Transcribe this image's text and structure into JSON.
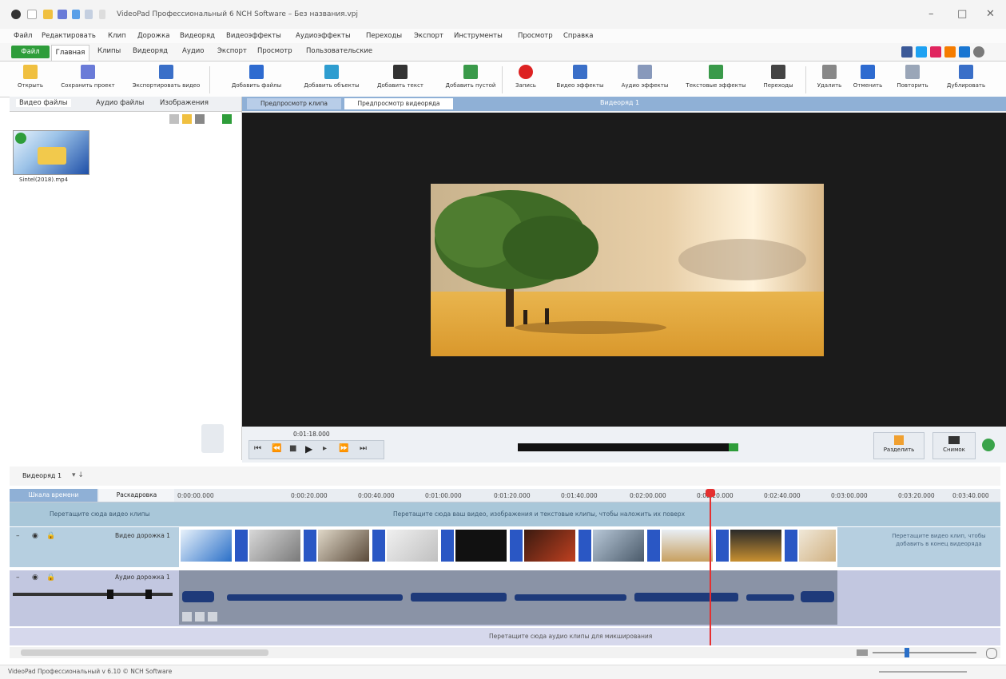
{
  "title_bar": {
    "title": "VideoPad Профессиональный 6 NCH Software – Без названия.vpj",
    "minimize": "–",
    "maximize": "□",
    "close": "✕"
  },
  "menu": [
    "Файл",
    "Редактировать",
    "Клип",
    "Дорожка",
    "Видеоряд",
    "Видеоэффекты",
    "Аудиоэффекты",
    "Переходы",
    "Экспорт",
    "Инструменты",
    "Просмотр",
    "Справка"
  ],
  "ribbon_tabs": {
    "file": "Файл",
    "home": "Главная",
    "others": [
      "Клипы",
      "Видеоряд",
      "Аудио",
      "Экспорт",
      "Просмотр",
      "Пользовательские"
    ]
  },
  "ribbon_buttons": [
    {
      "label": "Открыть",
      "icon": "folder-icon",
      "color": "#f0c040"
    },
    {
      "label": "Сохранить проект",
      "icon": "save-icon",
      "color": "#6a7bd8"
    },
    {
      "label": "Экспортировать видео",
      "icon": "export-icon",
      "color": "#3a6fc8"
    },
    {
      "label": "Добавить файлы",
      "icon": "add-files-icon",
      "color": "#2e6bd0"
    },
    {
      "label": "Добавить объекты",
      "icon": "add-objects-icon",
      "color": "#2e9dd0"
    },
    {
      "label": "Добавить текст",
      "icon": "add-text-icon",
      "color": "#333333"
    },
    {
      "label": "Добавить пустой",
      "icon": "add-blank-icon",
      "color": "#3a9a4a"
    },
    {
      "label": "Запись",
      "icon": "record-icon",
      "color": "#dd2222"
    },
    {
      "label": "Видео эффекты",
      "icon": "video-effects-icon",
      "color": "#3a6fc8"
    },
    {
      "label": "Аудио эффекты",
      "icon": "audio-effects-icon",
      "color": "#8899bb"
    },
    {
      "label": "Текстовые эффекты",
      "icon": "text-effects-icon",
      "color": "#3a9a4a"
    },
    {
      "label": "Переходы",
      "icon": "transitions-icon",
      "color": "#444444"
    },
    {
      "label": "Удалить",
      "icon": "delete-icon",
      "color": "#888888"
    },
    {
      "label": "Отменить",
      "icon": "undo-icon",
      "color": "#2e6bd0"
    },
    {
      "label": "Повторить",
      "icon": "redo-icon",
      "color": "#9aa6b8"
    },
    {
      "label": "Дублировать",
      "icon": "duplicate-icon",
      "color": "#3a6fc8"
    }
  ],
  "left_panel": {
    "tabs": [
      "Видео файлы",
      "Аудио файлы",
      "Изображения"
    ],
    "file_name": "Sintel(2018).mp4"
  },
  "preview": {
    "tab_clip": "Предпросмотр клипа",
    "tab_sequence": "Предпросмотр видеоряда",
    "sequence_title": "Видеоряд 1",
    "time": "0:01:18.000",
    "split_label": "Разделить",
    "snapshot_label": "Снимок"
  },
  "timeline": {
    "sequence_tab": "Видеоряд 1",
    "tab_timeline": "Шкала времени",
    "tab_storyboard": "Раскадровка",
    "ticks": [
      "0:00:00.000",
      "0:00:20.000",
      "0:00:40.000",
      "0:01:00.000",
      "0:01:20.000",
      "0:01:40.000",
      "0:02:00.000",
      "0:02:20.000",
      "0:02:40.000",
      "0:03:00.000",
      "0:03:20.000",
      "0:03:40.000"
    ],
    "overlay_hint": "Перетащите сюда видео клипы",
    "overlay_label": "Перетащите сюда ваш видео, изображения и текстовые клипы, чтобы наложить их поверх",
    "video_track": "Видео дорожка 1",
    "audio_track": "Аудио дорожка 1",
    "drop_right": "Перетащите видео клип, чтобы добавить в конец видеоряда",
    "audio_drop": "Перетащите сюда аудио клипы для микширования"
  },
  "status": "VideoPad Профессиональный v 6.10 © NCH Software"
}
